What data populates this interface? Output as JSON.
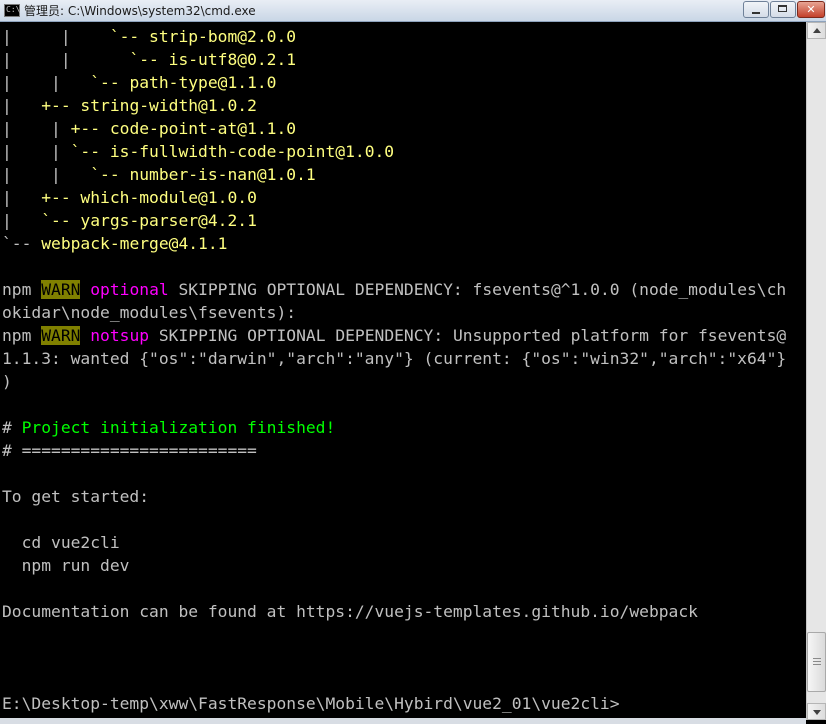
{
  "window": {
    "title": "管理员: C:\\Windows\\system32\\cmd.exe",
    "app_icon_text": "C:\\",
    "close_glyph": "✕"
  },
  "console": {
    "lines": [
      [
        {
          "t": "|     |    ",
          "c": "g"
        },
        {
          "t": "`-- strip-bom@2.0.0",
          "c": "y"
        }
      ],
      [
        {
          "t": "|     |      ",
          "c": "g"
        },
        {
          "t": "`-- is-utf8@0.2.1",
          "c": "y"
        }
      ],
      [
        {
          "t": "|    |   ",
          "c": "g"
        },
        {
          "t": "`-- path-type@1.1.0",
          "c": "y"
        }
      ],
      [
        {
          "t": "|   ",
          "c": "g"
        },
        {
          "t": "+-- string-width@1.0.2",
          "c": "y"
        }
      ],
      [
        {
          "t": "|    | ",
          "c": "g"
        },
        {
          "t": "+-- code-point-at@1.1.0",
          "c": "y"
        }
      ],
      [
        {
          "t": "|    | ",
          "c": "g"
        },
        {
          "t": "`-- is-fullwidth-code-point@1.0.0",
          "c": "y"
        }
      ],
      [
        {
          "t": "|    |   ",
          "c": "g"
        },
        {
          "t": "`-- number-is-nan@1.0.1",
          "c": "y"
        }
      ],
      [
        {
          "t": "|   ",
          "c": "g"
        },
        {
          "t": "+-- which-module@1.0.0",
          "c": "y"
        }
      ],
      [
        {
          "t": "|   ",
          "c": "g"
        },
        {
          "t": "`-- yargs-parser@4.2.1",
          "c": "y"
        }
      ],
      [
        {
          "t": "`-- ",
          "c": "g"
        },
        {
          "t": "webpack-merge@4.1.1",
          "c": "y"
        }
      ],
      [],
      [
        {
          "t": "npm ",
          "c": "g"
        },
        {
          "t": "WARN",
          "c": "warn"
        },
        {
          "t": " ",
          "c": "g"
        },
        {
          "t": "optional",
          "c": "m"
        },
        {
          "t": " SKIPPING OPTIONAL DEPENDENCY: fsevents@^1.0.0 (node_modules\\ch",
          "c": "g"
        }
      ],
      [
        {
          "t": "okidar\\node_modules\\fsevents):",
          "c": "g"
        }
      ],
      [
        {
          "t": "npm ",
          "c": "g"
        },
        {
          "t": "WARN",
          "c": "warn"
        },
        {
          "t": " ",
          "c": "g"
        },
        {
          "t": "notsup",
          "c": "m"
        },
        {
          "t": " SKIPPING OPTIONAL DEPENDENCY: Unsupported platform for fsevents@",
          "c": "g"
        }
      ],
      [
        {
          "t": "1.1.3: wanted {\"os\":\"darwin\",\"arch\":\"any\"} (current: {\"os\":\"win32\",\"arch\":\"x64\"}",
          "c": "g"
        }
      ],
      [
        {
          "t": ")",
          "c": "g"
        }
      ],
      [],
      [
        {
          "t": "# ",
          "c": "g"
        },
        {
          "t": "Project initialization finished!",
          "c": "lime"
        }
      ],
      [
        {
          "t": "# ========================",
          "c": "g"
        }
      ],
      [],
      [
        {
          "t": "To get started:",
          "c": "g"
        }
      ],
      [],
      [
        {
          "t": "  cd vue2cli",
          "c": "g"
        }
      ],
      [
        {
          "t": "  npm run dev",
          "c": "g"
        }
      ],
      [],
      [
        {
          "t": "Documentation can be found at https://vuejs-templates.github.io/webpack",
          "c": "g"
        }
      ],
      [],
      [],
      [],
      [
        {
          "t": "E:\\Desktop-temp\\xww\\FastResponse\\Mobile\\Hybird\\vue2_01\\vue2cli>",
          "c": "g"
        }
      ]
    ]
  }
}
